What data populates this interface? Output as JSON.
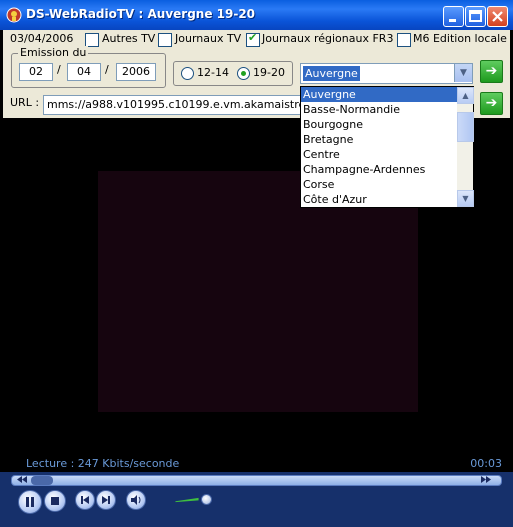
{
  "window": {
    "title": "DS-WebRadioTV : Auvergne 19-20"
  },
  "filters": {
    "date": "03/04/2006",
    "options": [
      {
        "label": "Autres TV",
        "checked": false
      },
      {
        "label": "Journaux TV",
        "checked": false
      },
      {
        "label": "Journaux régionaux FR3",
        "checked": true
      },
      {
        "label": "M6 Edition locale",
        "checked": false
      }
    ]
  },
  "emission": {
    "group_label": "Emission du",
    "day": "02",
    "month": "04",
    "year": "2006",
    "separator": "/"
  },
  "time_slots": [
    {
      "label": "12-14",
      "selected": false
    },
    {
      "label": "19-20",
      "selected": true
    }
  ],
  "region_select": {
    "value": "Auvergne",
    "options": [
      "Auvergne",
      "Basse-Normandie",
      "Bourgogne",
      "Bretagne",
      "Centre",
      "Champagne-Ardennes",
      "Corse",
      "Côte d'Azur"
    ]
  },
  "url": {
    "label": "URL :",
    "value": "mms://a988.v101995.c10199.e.vm.akamaistream.net"
  },
  "status": {
    "reading": "Lecture : 247 Kbits/seconde",
    "time": "00:03"
  },
  "player": {
    "play_pause_icon": "pause-icon",
    "stop_icon": "stop-icon",
    "prev_icon": "previous-icon",
    "next_icon": "next-icon",
    "mute_icon": "speaker-icon",
    "volume": 0.85,
    "progress": 0.04
  },
  "colors": {
    "titlebar": "#0A54D8",
    "status_text": "#6A9AD8",
    "selection": "#316AC5"
  }
}
